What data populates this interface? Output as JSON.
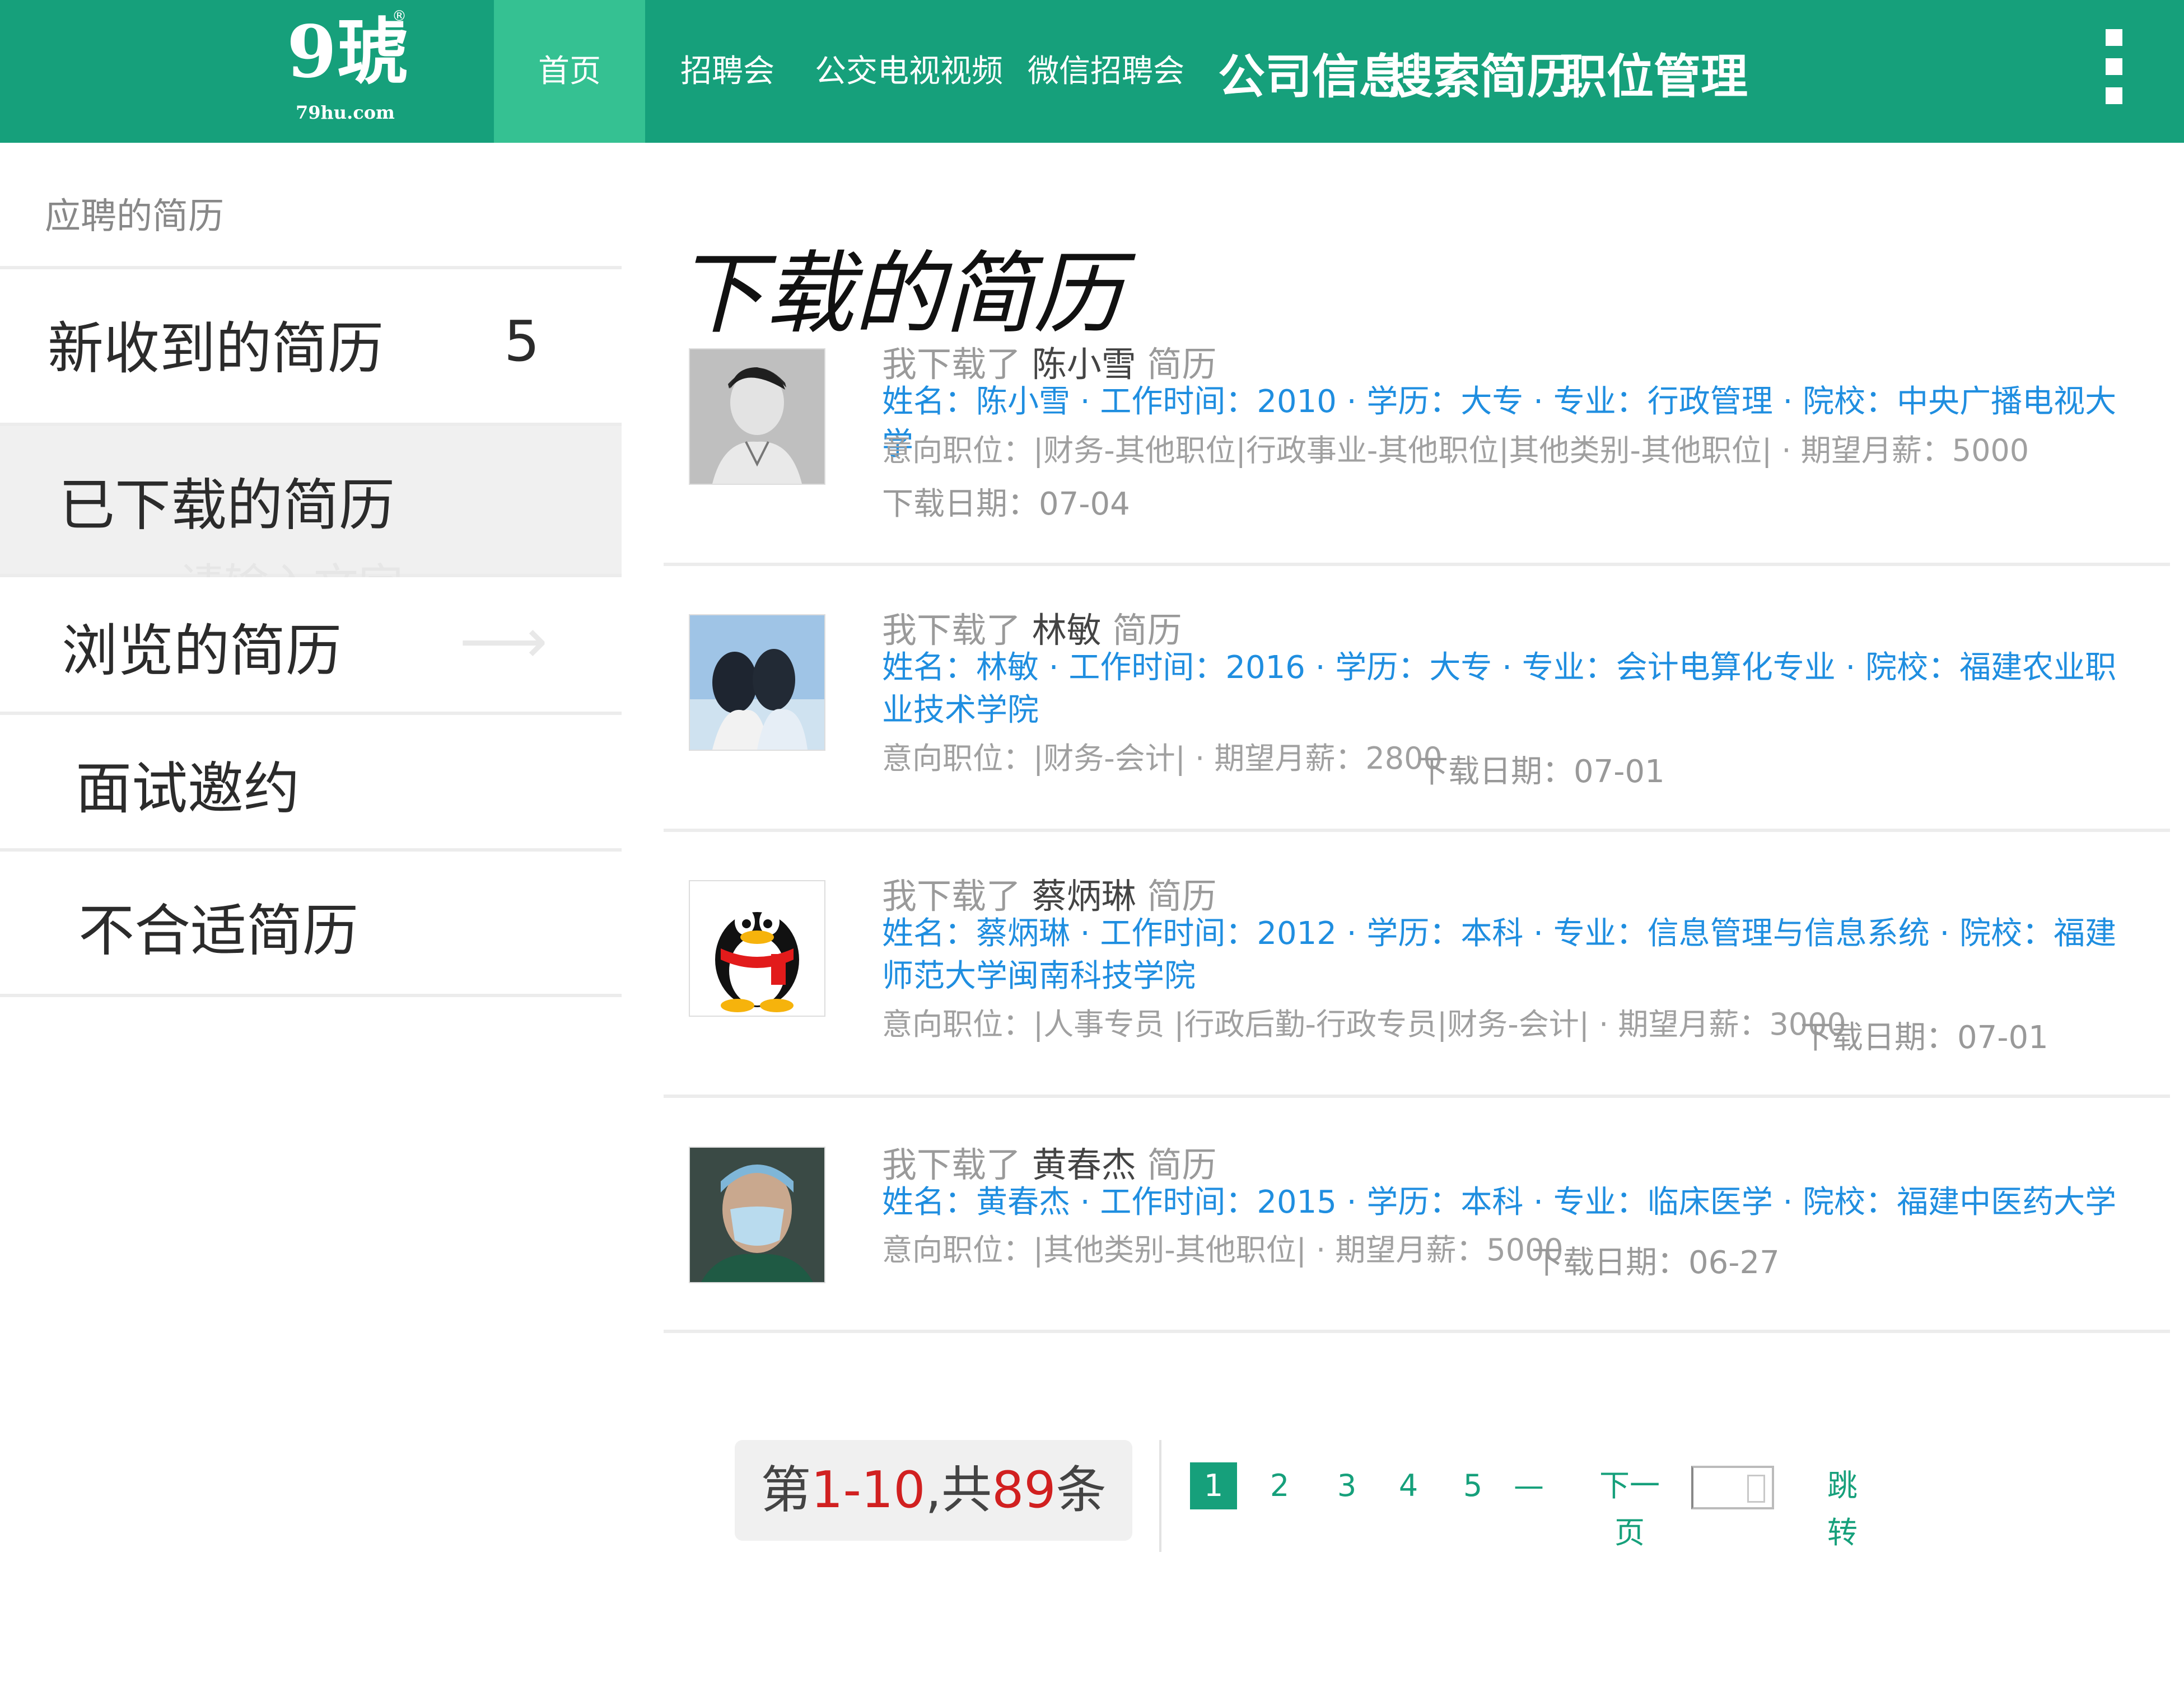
{
  "brand": {
    "logo_text": "9琥",
    "logo_registered": "®",
    "logo_domain": "79hu.com"
  },
  "nav": {
    "home": "首页",
    "items": [
      "招聘会",
      "公交电视视频",
      "微信招聘会"
    ],
    "big_items": [
      "公司信息",
      "搜索简历",
      "职位管理"
    ]
  },
  "sidebar": {
    "header": "应聘的简历",
    "items": [
      {
        "label": "新收到的简历",
        "count": "5"
      },
      {
        "label": "已下载的简历"
      },
      {
        "label": "浏览的简历"
      },
      {
        "label": "面试邀约"
      },
      {
        "label": "不合适简历"
      }
    ],
    "ghost_placeholder": "请输入文字",
    "ghost_arrow": "⟶"
  },
  "main": {
    "title": "下载的简历",
    "cards": [
      {
        "head_prefix": "我下载了",
        "name": "陈小雪",
        "head_suffix": "简历",
        "info": "姓名：陈小雪 · 工作时间：2010 · 学历：大专 · 专业：行政管理 · 院校：中央广播电视大学",
        "intent": "意向职位：|财务-其他职位|行政事业-其他职位|其他类别-其他职位| · 期望月薪：5000",
        "date": "下载日期：07-04"
      },
      {
        "head_prefix": "我下载了",
        "name": "林敏",
        "head_suffix": "简历",
        "info": "姓名：林敏 · 工作时间：2016 · 学历：大专 · 专业：会计电算化专业 · 院校：福建农业职业技术学院",
        "intent": "意向职位：|财务-会计| · 期望月薪：2800",
        "date": "下载日期：07-01"
      },
      {
        "head_prefix": "我下载了",
        "name": "蔡炳琳",
        "head_suffix": "简历",
        "info": "姓名：蔡炳琳 · 工作时间：2012 · 学历：本科 · 专业：信息管理与信息系统 · 院校：福建师范大学闽南科技学院",
        "intent": "意向职位：|人事专员 |行政后勤-行政专员|财务-会计| · 期望月薪：3000",
        "date": "下载日期：07-01"
      },
      {
        "head_prefix": "我下载了",
        "name": "黄春杰",
        "head_suffix": "简历",
        "info": "姓名：黄春杰 · 工作时间：2015 · 学历：本科 · 专业：临床医学 · 院校：福建中医药大学",
        "intent": "意向职位：|其他类别-其他职位| · 期望月薪：5000",
        "date": "下载日期：06-27"
      }
    ]
  },
  "pagination": {
    "prefix": "第",
    "range": "1-10",
    "middle": ",共",
    "total": "89",
    "suffix": "条",
    "pages": [
      "1",
      "2",
      "3",
      "4",
      "5"
    ],
    "ellipsis": "—",
    "next": "下一页",
    "jump": "跳转"
  },
  "colors": {
    "brand_green": "#16a07b",
    "active_tab": "#35c192",
    "link_blue": "#1f8ee0",
    "count_red": "#d12020"
  }
}
